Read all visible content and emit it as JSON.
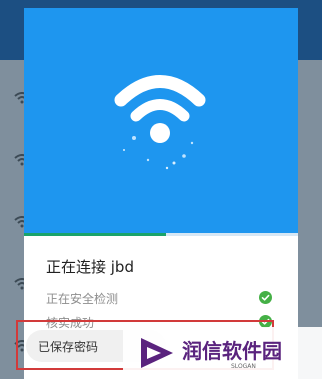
{
  "dialog": {
    "title": "正在连接 jbd",
    "connect_progress": 0.52,
    "steps": [
      {
        "label": "正在安全检测",
        "status": "done"
      },
      {
        "label": "核实成功",
        "status": "done"
      }
    ],
    "saved_password_label": "已保存密码"
  },
  "watermark": {
    "brand": "润信软件园",
    "slogan": "SLOGAN"
  },
  "colors": {
    "hero_blue": "#1e96ef",
    "check_green": "#45b046",
    "highlight_red": "#d23a3a",
    "brand_purple": "#5a237e"
  }
}
